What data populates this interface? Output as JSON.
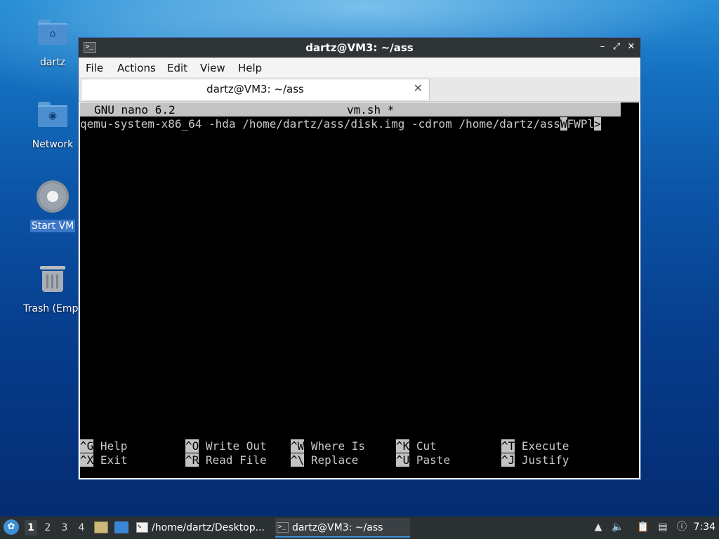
{
  "desktop": {
    "icons": [
      {
        "label": "dartz",
        "icon": "home-folder-icon"
      },
      {
        "label": "Network",
        "icon": "network-folder-icon"
      },
      {
        "label": "Start VM",
        "icon": "gear-icon"
      },
      {
        "label": "Trash (Empt",
        "icon": "trash-icon"
      }
    ]
  },
  "window": {
    "title": "dartz@VM3: ~/ass",
    "menu": [
      "File",
      "Actions",
      "Edit",
      "View",
      "Help"
    ],
    "tab_label": "dartz@VM3: ~/ass",
    "controls": {
      "minimize": "–",
      "maximize": "⤢",
      "close": "✕"
    }
  },
  "nano": {
    "version": "GNU nano 6.2",
    "filename": "vm.sh *",
    "line": "qemu-system-x86_64 -hda /home/dartz/ass/disk.img -cdrom /home/dartz/ass",
    "cursor_char": "W",
    "line_tail": "FWPl",
    "overflow_marker": ">",
    "shortcuts": [
      {
        "key": "^G",
        "label": "Help"
      },
      {
        "key": "^O",
        "label": "Write Out"
      },
      {
        "key": "^W",
        "label": "Where Is"
      },
      {
        "key": "^K",
        "label": "Cut"
      },
      {
        "key": "^T",
        "label": "Execute"
      },
      {
        "key": "^X",
        "label": "Exit"
      },
      {
        "key": "^R",
        "label": "Read File"
      },
      {
        "key": "^\\",
        "label": "Replace"
      },
      {
        "key": "^U",
        "label": "Paste"
      },
      {
        "key": "^J",
        "label": "Justify"
      }
    ]
  },
  "taskbar": {
    "workspaces": [
      "1",
      "2",
      "3",
      "4"
    ],
    "active_workspace": "1",
    "tasks": [
      {
        "label": "/home/dartz/Desktop...",
        "icon": "text-editor-icon",
        "active": false
      },
      {
        "label": "dartz@VM3: ~/ass",
        "icon": "terminal-icon",
        "active": true
      }
    ],
    "clock": "7:34"
  }
}
